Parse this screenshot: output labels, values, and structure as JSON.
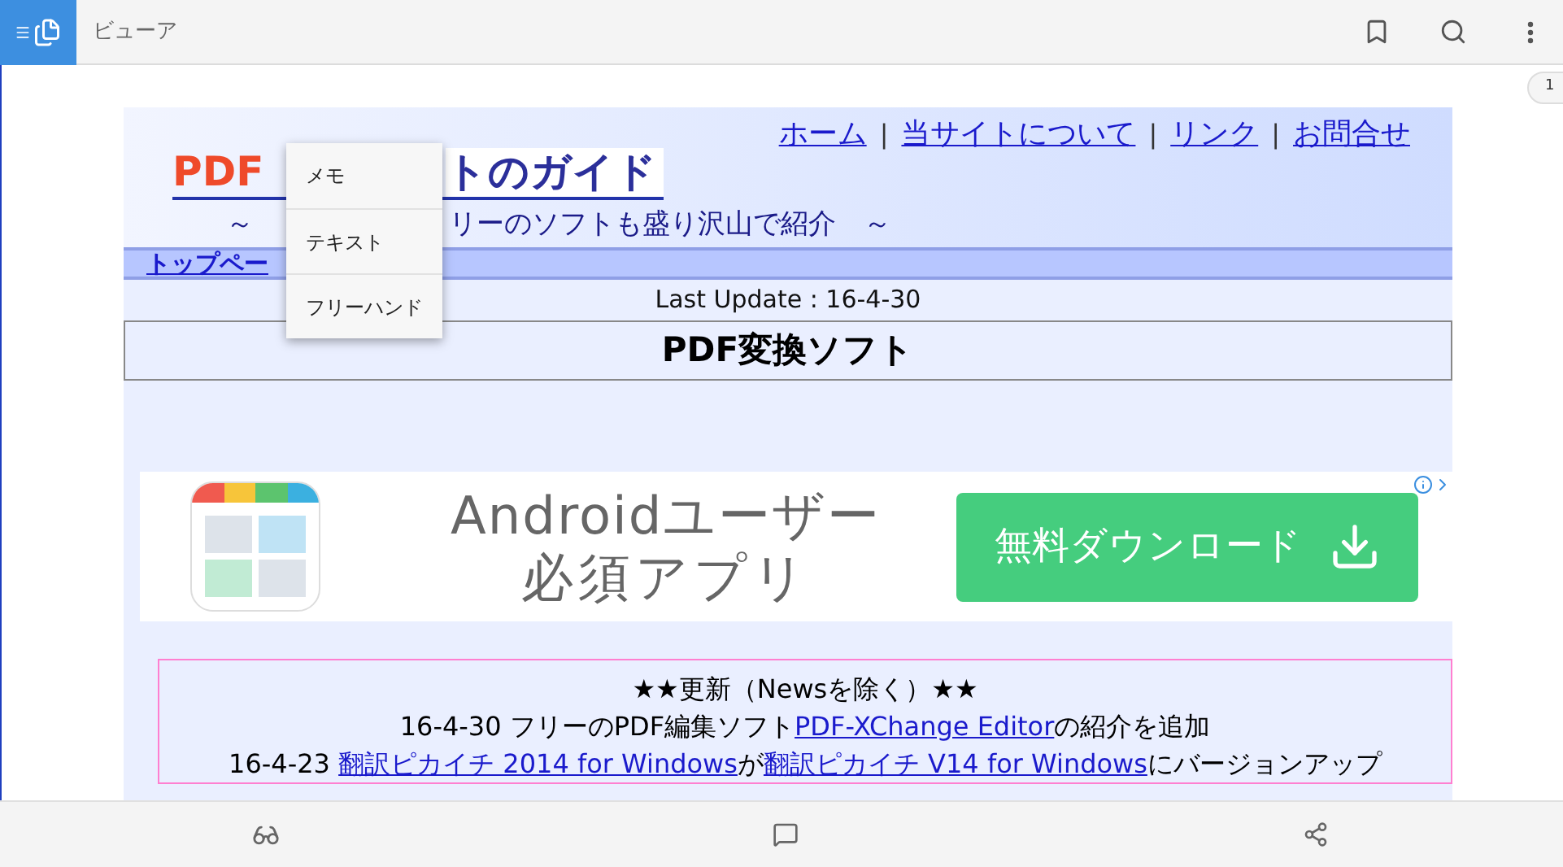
{
  "toolbar": {
    "title": "ビューア"
  },
  "page_badge": "1",
  "page": {
    "nav_links": [
      {
        "kind": "link",
        "text": "ホーム"
      },
      {
        "kind": "separator",
        "text": "|"
      },
      {
        "kind": "link",
        "text": "当サイトについて"
      },
      {
        "kind": "separator",
        "text": "|"
      },
      {
        "kind": "link",
        "text": "リンク"
      },
      {
        "kind": "separator",
        "text": "|"
      },
      {
        "kind": "link",
        "text": "お問合せ"
      }
    ],
    "logo": {
      "part_1": "PDF",
      "part_2": "トのガイド"
    },
    "subtitle": {
      "part_1": "～",
      "part_2": "リーのソフトも盛り沢山で紹介　～"
    },
    "breadcrumb": "トップペー",
    "last_update": "Last Update : 16-4-30",
    "heading": "PDF変換ソフト",
    "ad": {
      "headline": "Androidユーザー",
      "subline": "必須アプリ",
      "button": "無料ダウンロード"
    },
    "news": {
      "title": "★★更新（Newsを除く）★★",
      "items": [
        {
          "segments": [
            {
              "kind": "text",
              "text": "16-4-30 フリーのPDF編集ソフト"
            },
            {
              "kind": "link",
              "text": "PDF-XChange Editor"
            },
            {
              "kind": "text",
              "text": "の紹介を追加"
            }
          ]
        },
        {
          "segments": [
            {
              "kind": "text",
              "text": "16-4-23 "
            },
            {
              "kind": "link",
              "text": "翻訳ピカイチ 2014 for Windows"
            },
            {
              "kind": "text",
              "text": "が"
            },
            {
              "kind": "link",
              "text": "翻訳ピカイチ V14 for Windows"
            },
            {
              "kind": "text",
              "text": "にバージョンアップ"
            }
          ]
        }
      ]
    }
  },
  "popup_menu": {
    "items": [
      "メモ",
      "テキスト",
      "フリーハンド"
    ]
  }
}
